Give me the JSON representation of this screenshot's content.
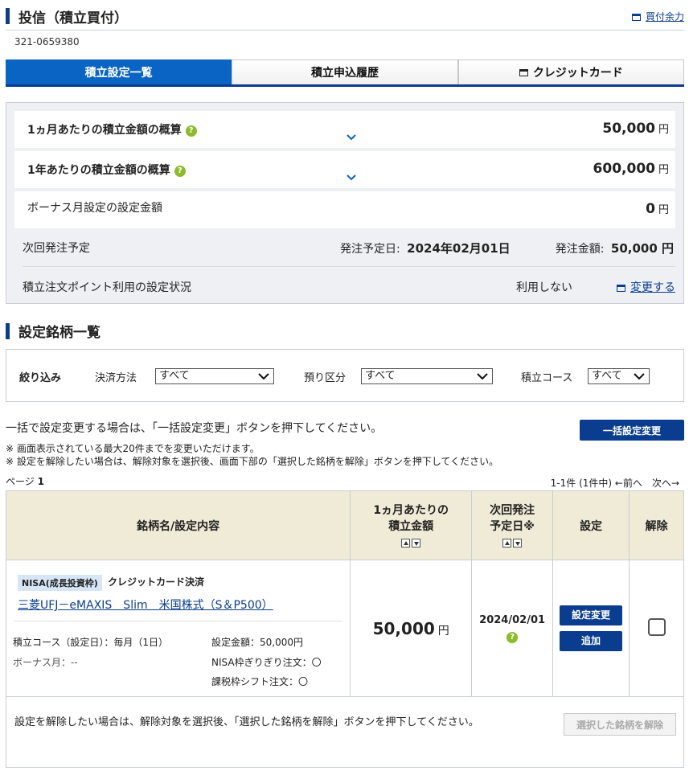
{
  "header": {
    "title": "投信（積立買付）",
    "link": "買付余力"
  },
  "account_number": "321-0659380",
  "tabs": [
    {
      "label": "積立設定一覧",
      "active": true
    },
    {
      "label": "積立申込履歴",
      "active": false
    },
    {
      "label": "クレジットカード",
      "active": false
    }
  ],
  "summary": {
    "monthly_label": "1ヵ月あたりの積立金額の概算",
    "monthly_value": "50,000",
    "yearly_label": "1年あたりの積立金額の概算",
    "yearly_value": "600,000",
    "bonus_label": "ボーナス月設定の設定金額",
    "bonus_value": "0",
    "currency": "円",
    "next_order_label": "次回発注予定",
    "next_order_date_label": "発注予定日:",
    "next_order_date": "2024年02月01日",
    "next_order_amount_label": "発注金額:",
    "next_order_amount": "50,000 円",
    "point_label": "積立注文ポイント利用の設定状況",
    "point_status": "利用しない",
    "point_change_link": "変更する"
  },
  "section2_title": "設定銘柄一覧",
  "filter": {
    "title": "絞り込み",
    "payment_label": "決済方法",
    "payment_value": "すべて",
    "account_label": "預り区分",
    "account_value": "すべて",
    "course_label": "積立コース",
    "course_value": "すべて"
  },
  "notes": {
    "bulk_note": "一括で設定変更する場合は、「一括設定変更」ボタンを押下してください。",
    "bulk_button": "一括設定変更",
    "note1": "※ 画面表示されている最大20件までを変更いただけます。",
    "note2": "※ 設定を解除したい場合は、解除対象を選択後、画面下部の「選択した銘柄を解除」ボタンを押下してください。",
    "page_label": "ページ",
    "page_number": "1",
    "pager": "1-1件 (1件中) ←前へ　次へ→"
  },
  "table": {
    "headers": {
      "fund": "銘柄名/設定内容",
      "monthly_1": "1ヵ月あたりの",
      "monthly_2": "積立金額",
      "next_1": "次回発注",
      "next_2": "予定日※",
      "setting": "設定",
      "cancel": "解除"
    },
    "rows": [
      {
        "badge": "NISA(成長投資枠)",
        "payment": "クレジットカード決済",
        "fund_name": "三菱UFJ－eMAXIS　Slim　米国株式（S＆P500）",
        "course": "積立コース（設定日）：毎月（1日）",
        "bonus": "ボーナス月：--",
        "set_amount": "設定金額：50,000円",
        "nisa_limit": "NISA枠ぎりぎり注文：〇",
        "tax_shift": "課税枠シフト注文：〇",
        "monthly_amount": "50,000",
        "currency": "円",
        "next_date": "2024/02/01",
        "change_button": "設定変更",
        "add_button": "追加"
      }
    ],
    "footer_note": "設定を解除したい場合は、解除対象を選択後、「選択した銘柄を解除」ボタンを押下してください。",
    "remove_button": "選択した銘柄を解除"
  },
  "colors": {
    "brand": "#0a3d8f",
    "tab_active": "#0a64c4",
    "help": "#8dbb2b",
    "table_header": "#efebd6"
  }
}
